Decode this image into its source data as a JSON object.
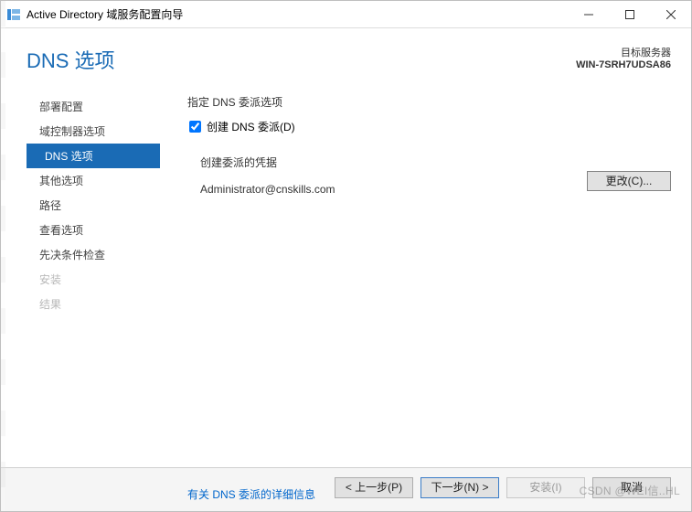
{
  "titlebar": {
    "title": "Active Directory 域服务配置向导"
  },
  "header": {
    "page_title": "DNS 选项",
    "target_label": "目标服务器",
    "target_name": "WIN-7SRH7UDSA86"
  },
  "sidebar": {
    "items": [
      {
        "label": "部署配置",
        "state": "normal"
      },
      {
        "label": "域控制器选项",
        "state": "normal"
      },
      {
        "label": "DNS 选项",
        "state": "selected"
      },
      {
        "label": "其他选项",
        "state": "normal"
      },
      {
        "label": "路径",
        "state": "normal"
      },
      {
        "label": "查看选项",
        "state": "normal"
      },
      {
        "label": "先决条件检查",
        "state": "normal"
      },
      {
        "label": "安装",
        "state": "disabled"
      },
      {
        "label": "结果",
        "state": "disabled"
      }
    ]
  },
  "main": {
    "section_heading": "指定 DNS 委派选项",
    "checkbox_label": "创建 DNS 委派(D)",
    "checkbox_checked": true,
    "credentials_heading": "创建委派的凭据",
    "credentials_value": "Administrator@cnskills.com",
    "change_button": "更改(C)...",
    "more_link": "有关 DNS 委派的详细信息"
  },
  "footer": {
    "prev": "< 上一步(P)",
    "next": "下一步(N) >",
    "install": "安装(I)",
    "cancel": "取消"
  },
  "watermark": "CSDN @WEI信..HL"
}
